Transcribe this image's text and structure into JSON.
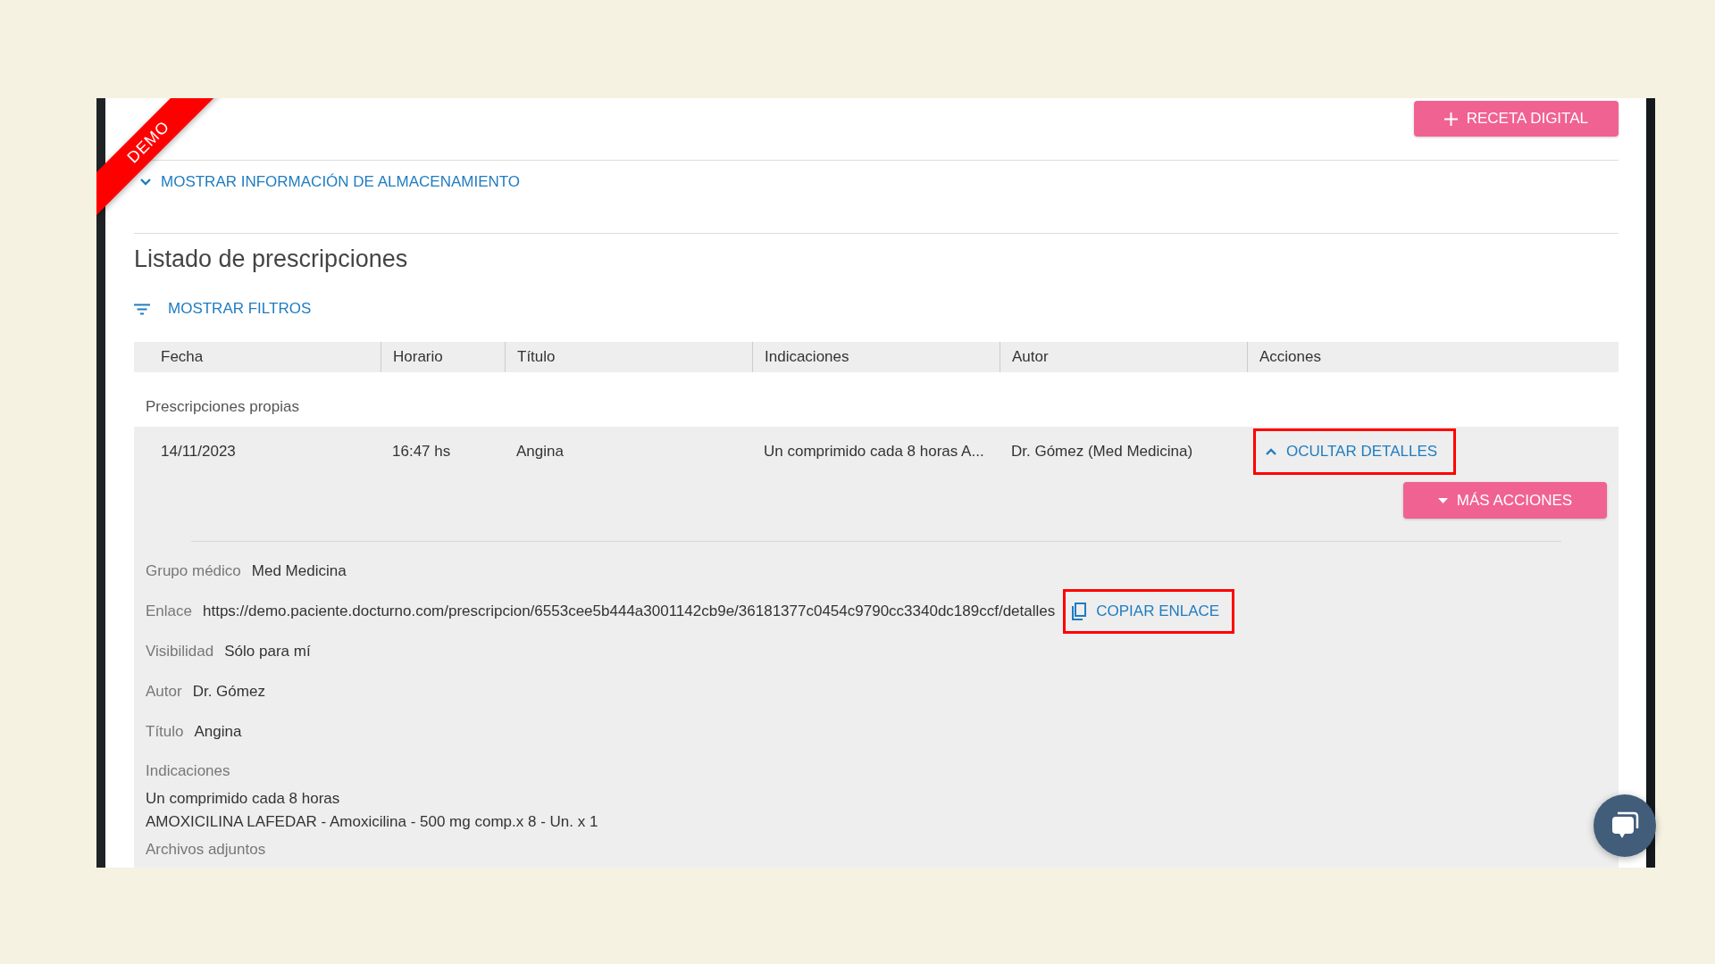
{
  "demo_ribbon": "DEMO",
  "new_button": {
    "label": "RECETA DIGITAL"
  },
  "storage_toggle": {
    "label": "MOSTRAR INFORMACIÓN DE ALMACENAMIENTO",
    "expanded": false
  },
  "title": "Listado de prescripciones",
  "filters_toggle": {
    "label": "MOSTRAR FILTROS"
  },
  "table": {
    "columns": [
      "Fecha",
      "Horario",
      "Título",
      "Indicaciones",
      "Autor",
      "Acciones"
    ],
    "group": "Prescripciones propias",
    "rows": [
      {
        "cells": [
          "14/11/2023",
          "16:47 hs",
          "Angina",
          "Un comprimido cada 8 horas A...",
          "Dr. Gómez (Med Medicina)"
        ],
        "expanded": true,
        "details_button": {
          "label": "OCULTAR DETALLES",
          "highlighted": true
        },
        "more_button": {
          "label": "MÁS ACCIONES"
        },
        "details": [
          {
            "kind": "inline",
            "label": "Grupo médico",
            "value": "Med Medicina"
          },
          {
            "kind": "link",
            "label": "Enlace",
            "value": "https://demo.paciente.docturno.com/prescripcion/6553cee5b444a3001142cb9e/36181377c0454c9790cc3340dc189ccf/detalles",
            "copy_button": {
              "label": "COPIAR ENLACE",
              "highlighted": true
            }
          },
          {
            "kind": "inline",
            "label": "Visibilidad",
            "value": "Sólo para mí"
          },
          {
            "kind": "inline",
            "label": "Autor",
            "value": "Dr. Gómez"
          },
          {
            "kind": "inline",
            "label": "Título",
            "value": "Angina"
          },
          {
            "kind": "block",
            "label": "Indicaciones",
            "lines": [
              "Un comprimido cada 8 horas",
              "AMOXICILINA LAFEDAR - Amoxicilina - 500 mg comp.x 8 - Un. x 1"
            ]
          },
          {
            "kind": "heading",
            "label": "Archivos adjuntos"
          }
        ]
      }
    ]
  }
}
